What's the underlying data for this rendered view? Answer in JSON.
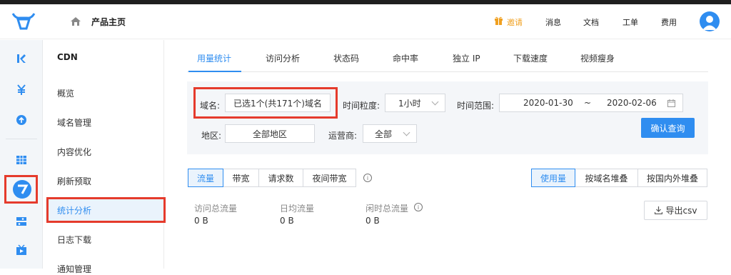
{
  "header": {
    "page_title": "产品主页",
    "nav": [
      "邀请",
      "消息",
      "文档",
      "工单",
      "费用"
    ]
  },
  "sidebar": {
    "title": "CDN",
    "items": [
      "概览",
      "域名管理",
      "内容优化",
      "刷新预取",
      "统计分析",
      "日志下载",
      "通知管理"
    ],
    "active_index": 4
  },
  "tabs": [
    "用量统计",
    "访问分析",
    "状态码",
    "命中率",
    "独立 IP",
    "下载速度",
    "视频瘦身"
  ],
  "filter": {
    "domain_label": "域名:",
    "domain_value": "已选1个(共171个)域名",
    "granularity_label": "时间粒度:",
    "granularity_value": "1小时",
    "range_label": "时间范围:",
    "date_start": "2020-01-30",
    "date_sep": "~",
    "date_end": "2020-02-06",
    "region_label": "地区:",
    "region_value": "全部地区",
    "isp_label": "运营商:",
    "isp_value": "全部",
    "query_button": "确认查询"
  },
  "metric_tabs": [
    "流量",
    "带宽",
    "请求数",
    "夜间带宽"
  ],
  "view_tabs": [
    "使用量",
    "按域名堆叠",
    "按国内外堆叠"
  ],
  "stats": [
    {
      "label": "访问总流量",
      "value": "0 B"
    },
    {
      "label": "日均流量",
      "value": "0 B"
    },
    {
      "label": "闲时总流量",
      "value": "0 B"
    }
  ],
  "export_button": "导出csv",
  "colors": {
    "accent": "#2f8df0",
    "highlight_box": "#e53b2c",
    "invite": "#f0a020"
  }
}
